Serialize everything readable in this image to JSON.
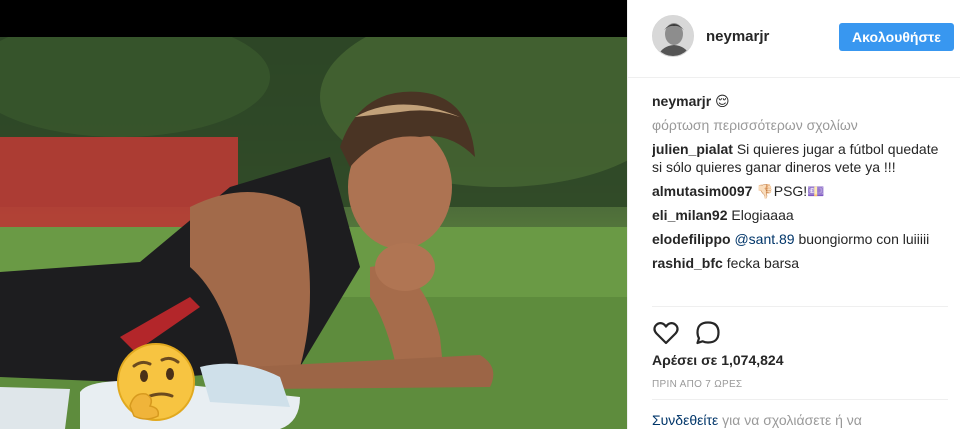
{
  "post": {
    "author": "neymarjr",
    "follow_label": "Ακολουθήστε"
  },
  "caption": {
    "username": "neymarjr",
    "text": "😌"
  },
  "load_more_label": "φόρτωση περισσότερων σχολίων",
  "comments": [
    {
      "username": "julien_pialat",
      "text": "Si quieres jugar a fútbol quedate si sólo quieres ganar dineros vete ya !!!"
    },
    {
      "username": "almutasim0097",
      "text": "👎🏻PSG!💷"
    },
    {
      "username": "eli_milan92",
      "text": "Elogiaaaa"
    },
    {
      "username": "elodefilippo",
      "mention": "@sant.89",
      "text": "buongiormo con luiiiii"
    },
    {
      "username": "rashid_bfc",
      "text": "fecka barsa"
    }
  ],
  "icons": {
    "like": "heart-icon",
    "comment": "comment-bubble-icon",
    "emoji_overlay": "thinking-face-emoji"
  },
  "likes_label": "Αρέσει σε 1,074,824",
  "timestamp": "ΠΡΙΝ ΑΠΟ 7 ΩΡΕΣ",
  "login_prompt": {
    "link": "Συνδεθείτε",
    "text": "για να σχολιάσετε ή να"
  },
  "colors": {
    "accent": "#3897f0",
    "link": "#003569",
    "muted": "#999999"
  }
}
